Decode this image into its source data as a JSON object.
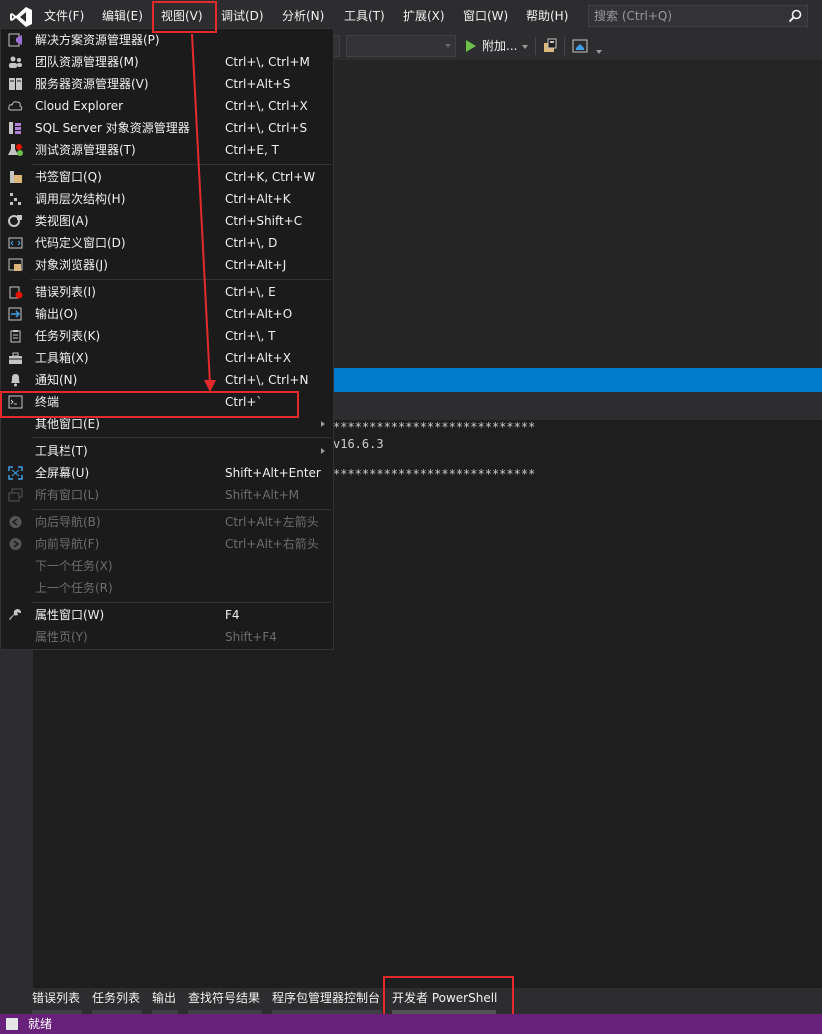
{
  "menubar": {
    "items": [
      "文件(F)",
      "编辑(E)",
      "视图(V)",
      "调试(D)",
      "分析(N)",
      "工具(T)",
      "扩展(X)",
      "窗口(W)",
      "帮助(H)"
    ],
    "search_placeholder": "搜索 (Ctrl+Q)"
  },
  "toolbar": {
    "attach_label": "附加..."
  },
  "view_menu": {
    "items": [
      {
        "label": "解决方案资源管理器(P)",
        "shortcut": "",
        "icon": "solution-explorer-icon"
      },
      {
        "label": "团队资源管理器(M)",
        "shortcut": "Ctrl+\\, Ctrl+M",
        "icon": "team-explorer-icon"
      },
      {
        "label": "服务器资源管理器(V)",
        "shortcut": "Ctrl+Alt+S",
        "icon": "server-explorer-icon"
      },
      {
        "label": "Cloud Explorer",
        "shortcut": "Ctrl+\\, Ctrl+X",
        "icon": "cloud-icon"
      },
      {
        "label": "SQL Server 对象资源管理器",
        "shortcut": "Ctrl+\\, Ctrl+S",
        "icon": "sql-server-icon"
      },
      {
        "label": "测试资源管理器(T)",
        "shortcut": "Ctrl+E, T",
        "icon": "test-explorer-icon"
      },
      {
        "label": "书签窗口(Q)",
        "shortcut": "Ctrl+K, Ctrl+W",
        "icon": "bookmark-icon"
      },
      {
        "label": "调用层次结构(H)",
        "shortcut": "Ctrl+Alt+K",
        "icon": "call-hierarchy-icon"
      },
      {
        "label": "类视图(A)",
        "shortcut": "Ctrl+Shift+C",
        "icon": "class-view-icon"
      },
      {
        "label": "代码定义窗口(D)",
        "shortcut": "Ctrl+\\, D",
        "icon": "code-definition-icon"
      },
      {
        "label": "对象浏览器(J)",
        "shortcut": "Ctrl+Alt+J",
        "icon": "object-browser-icon"
      },
      {
        "label": "错误列表(I)",
        "shortcut": "Ctrl+\\, E",
        "icon": "error-list-icon"
      },
      {
        "label": "输出(O)",
        "shortcut": "Ctrl+Alt+O",
        "icon": "output-icon"
      },
      {
        "label": "任务列表(K)",
        "shortcut": "Ctrl+\\, T",
        "icon": "task-list-icon"
      },
      {
        "label": "工具箱(X)",
        "shortcut": "Ctrl+Alt+X",
        "icon": "toolbox-icon"
      },
      {
        "label": "通知(N)",
        "shortcut": "Ctrl+\\, Ctrl+N",
        "icon": "bell-icon"
      },
      {
        "label": "终端",
        "shortcut": "Ctrl+`",
        "icon": "terminal-icon"
      },
      {
        "label": "其他窗口(E)",
        "shortcut": "",
        "icon": ""
      },
      {
        "label": "工具栏(T)",
        "shortcut": "",
        "icon": ""
      },
      {
        "label": "全屏幕(U)",
        "shortcut": "Shift+Alt+Enter",
        "icon": "fullscreen-icon"
      },
      {
        "label": "所有窗口(L)",
        "shortcut": "Shift+Alt+M",
        "icon": "all-windows-icon"
      },
      {
        "label": "向后导航(B)",
        "shortcut": "Ctrl+Alt+左箭头",
        "icon": "navigate-back-icon"
      },
      {
        "label": "向前导航(F)",
        "shortcut": "Ctrl+Alt+右箭头",
        "icon": "navigate-forward-icon"
      },
      {
        "label": "下一个任务(X)",
        "shortcut": "",
        "icon": ""
      },
      {
        "label": "上一个任务(R)",
        "shortcut": "",
        "icon": ""
      },
      {
        "label": "属性窗口(W)",
        "shortcut": "F4",
        "icon": "wrench-icon"
      },
      {
        "label": "属性页(Y)",
        "shortcut": "Shift+F4",
        "icon": ""
      }
    ]
  },
  "terminal": {
    "lines": [
      "****************************",
      "v16.6.3",
      "****************************"
    ]
  },
  "bottom_tabs": [
    "错误列表",
    "任务列表",
    "输出",
    "查找符号结果",
    "程序包管理器控制台",
    "开发者 PowerShell"
  ],
  "status": {
    "text": "就绪"
  },
  "colors": {
    "accent_blue": "#007acc",
    "status_purple": "#68217a",
    "highlight_red": "#e32b2b"
  }
}
